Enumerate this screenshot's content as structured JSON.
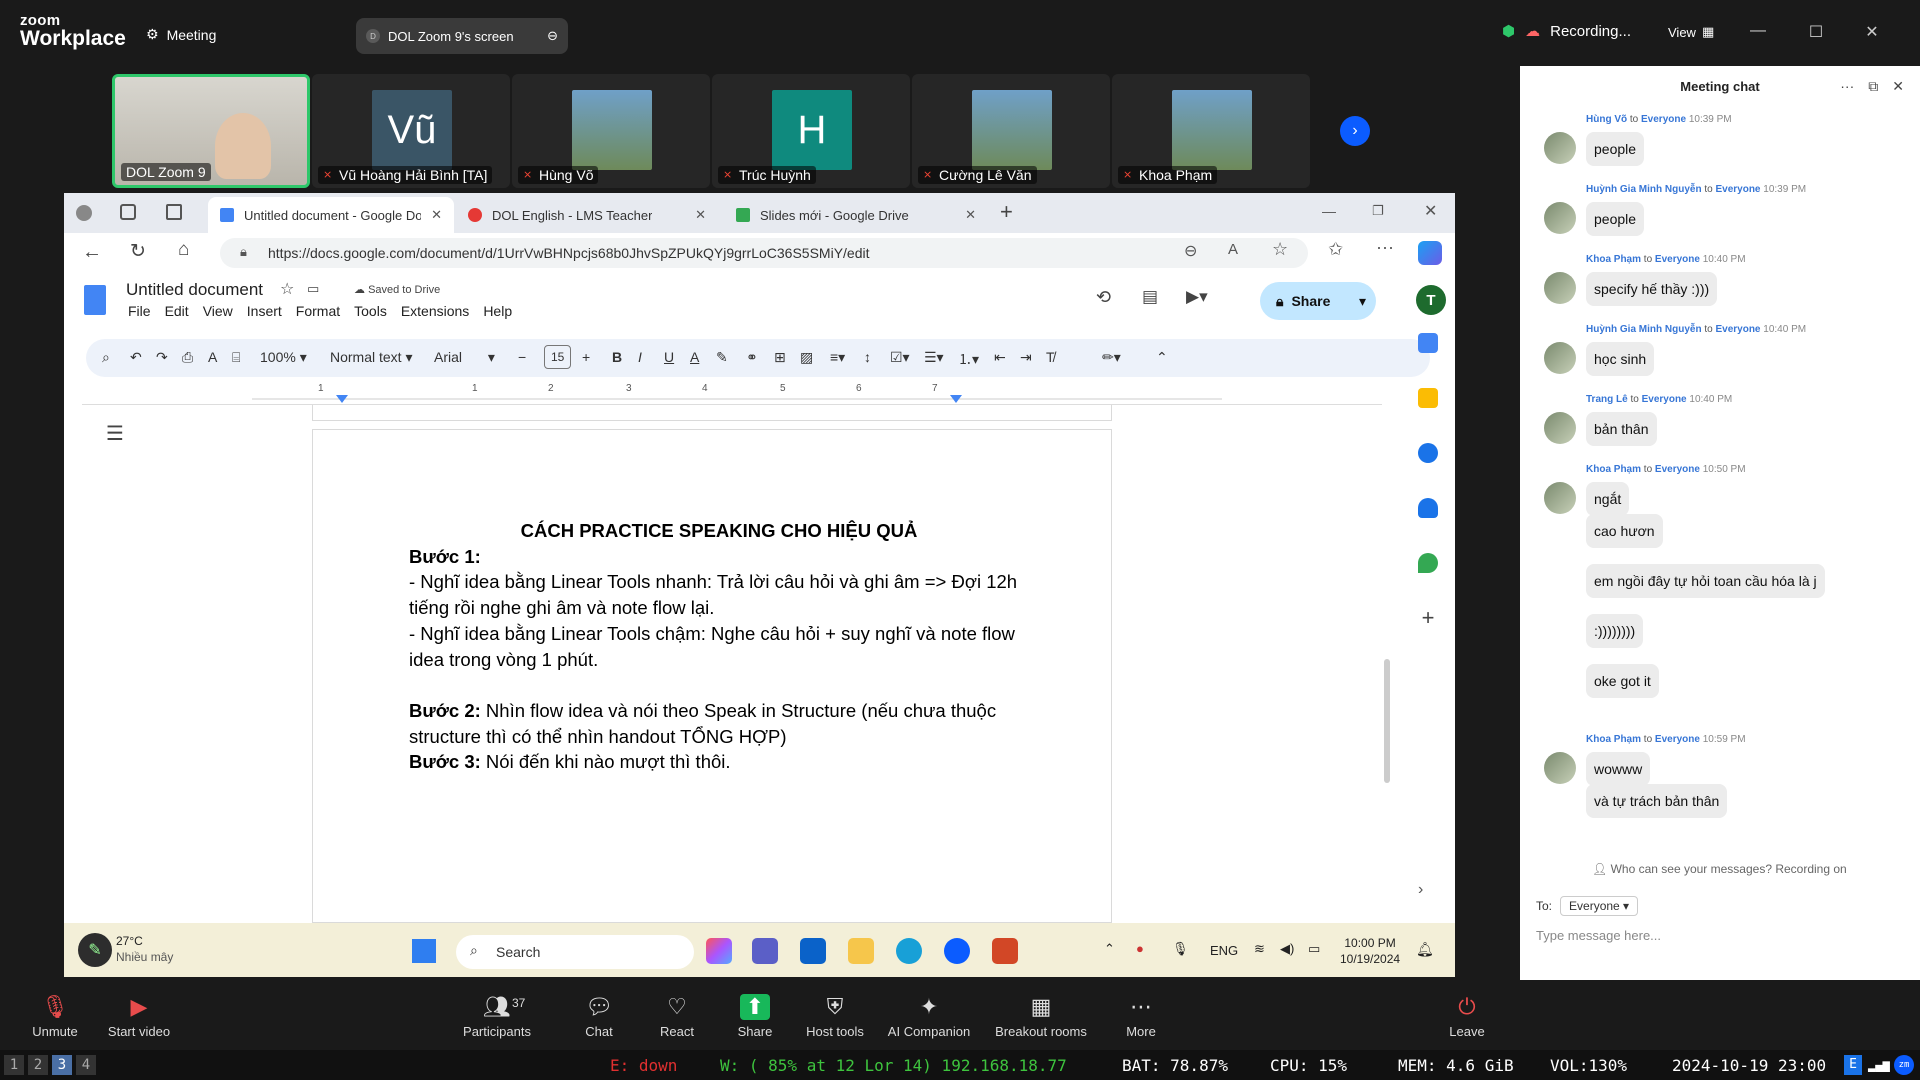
{
  "zoom": {
    "logo_line1": "zoom",
    "logo_line2": "Workplace",
    "meeting_label": "Meeting",
    "share_pill": {
      "initial": "D",
      "label": "DOL Zoom 9's screen"
    },
    "recording_label": "Recording...",
    "view_label": "View"
  },
  "thumbnails": [
    {
      "name": "DOL Zoom 9",
      "type": "video",
      "muted": false
    },
    {
      "name": "Vũ Hoàng Hải Bình [TA]",
      "type": "initials",
      "initials": "Vũ",
      "color": "#3a5566",
      "muted": true
    },
    {
      "name": "Hùng Võ",
      "type": "photo",
      "muted": true
    },
    {
      "name": "Trúc Huỳnh",
      "type": "initials",
      "initials": "H",
      "color": "#0f8a7e",
      "muted": true
    },
    {
      "name": "Cường Lê Văn",
      "type": "photo",
      "muted": true
    },
    {
      "name": "Khoa Phạm",
      "type": "photo",
      "muted": true
    }
  ],
  "chat": {
    "title": "Meeting chat",
    "messages": [
      {
        "sender": "Hùng Võ",
        "to": "to",
        "recipient": "Everyone",
        "time": "10:39 PM",
        "text": "people",
        "avatar": true
      },
      {
        "sender": "Huỳnh Gia Minh Nguyễn",
        "to": "to",
        "recipient": "Everyone",
        "time": "10:39 PM",
        "text": "people",
        "avatar": true
      },
      {
        "sender": "Khoa Phạm",
        "to": "to",
        "recipient": "Everyone",
        "time": "10:40 PM",
        "text": "specify hế thầy :)))",
        "avatar": true
      },
      {
        "sender": "Huỳnh Gia Minh Nguyễn",
        "to": "to",
        "recipient": "Everyone",
        "time": "10:40 PM",
        "text": "học sinh",
        "avatar": true
      },
      {
        "sender": "Trang Lê",
        "to": "to",
        "recipient": "Everyone",
        "time": "10:40 PM",
        "text": "bản thân",
        "avatar": true
      },
      {
        "sender": "Khoa Phạm",
        "to": "to",
        "recipient": "Everyone",
        "time": "10:50 PM",
        "text": "ngắt",
        "avatar": true
      },
      {
        "text": "cao hươn"
      },
      {
        "text": "em ngồi đây tự hỏi toan cầu hóa là j"
      },
      {
        "text": ":))))))))"
      },
      {
        "text": "oke got it"
      },
      {
        "sender": "Khoa Phạm",
        "to": "to",
        "recipient": "Everyone",
        "time": "10:59 PM",
        "text": "wowww",
        "avatar": true
      },
      {
        "text": "và tự trách bản thân"
      }
    ],
    "privacy_note": "Who can see your messages? Recording on",
    "to_label": "To:",
    "to_value": "Everyone",
    "input_placeholder": "Type message here..."
  },
  "browser": {
    "tabs": [
      {
        "label": "Untitled document - Google Docs",
        "active": true
      },
      {
        "label": "DOL English - LMS Teacher",
        "active": false
      },
      {
        "label": "Slides mới - Google Drive",
        "active": false
      }
    ],
    "url": "https://docs.google.com/document/d/1UrrVwBHNpcjs68b0JhvSpZPUkQYj9grrLoC36S5SMiY/edit"
  },
  "docs": {
    "title": "Untitled document",
    "saved_status": "Saved to Drive",
    "menu": [
      "File",
      "Edit",
      "View",
      "Insert",
      "Format",
      "Tools",
      "Extensions",
      "Help"
    ],
    "share_label": "Share",
    "avatar_initial": "T",
    "toolbar": {
      "zoom": "100%",
      "style": "Normal text",
      "font": "Arial",
      "size": "15"
    },
    "ruler_numbers": [
      "1",
      "1",
      "2",
      "3",
      "4",
      "5",
      "6",
      "7"
    ],
    "content": {
      "heading": "CÁCH PRACTICE SPEAKING CHO HIỆU QUẢ",
      "step1_label": "Bước 1:",
      "line1": "- Nghĩ idea bằng Linear Tools nhanh: Trả lời câu hỏi và ghi âm => Đợi 12h tiếng rồi nghe ghi âm và note flow lại.",
      "line2": "- Nghĩ idea bằng Linear Tools chậm: Nghe câu hỏi + suy nghĩ và note flow idea trong vòng 1 phút.",
      "step2_label": "Bước 2:",
      "step2_text": " Nhìn flow idea và nói theo Speak in Structure (nếu chưa thuộc structure thì có thể nhìn handout TỔNG HỢP)",
      "step3_label": "Bước 3:",
      "step3_text": " Nói đến khi nào mượt thì thôi."
    }
  },
  "taskbar": {
    "temp": "27°C",
    "weather": "Nhiều mây",
    "search_placeholder": "Search",
    "lang": "ENG",
    "time": "10:00 PM",
    "date": "10/19/2024"
  },
  "controls": [
    {
      "label": "Unmute",
      "icon": "mic-off-icon"
    },
    {
      "label": "Start video",
      "icon": "video-off-icon"
    },
    {
      "label": "Participants",
      "icon": "participants-icon",
      "count": "37"
    },
    {
      "label": "Chat",
      "icon": "chat-icon"
    },
    {
      "label": "React",
      "icon": "heart-icon"
    },
    {
      "label": "Share",
      "icon": "share-icon"
    },
    {
      "label": "Host tools",
      "icon": "shield-icon"
    },
    {
      "label": "AI Companion",
      "icon": "sparkle-icon"
    },
    {
      "label": "Breakout rooms",
      "icon": "grid-icon"
    },
    {
      "label": "More",
      "icon": "more-icon"
    },
    {
      "label": "Leave",
      "icon": "leave-icon"
    }
  ],
  "statusbar": {
    "workspaces": [
      "1",
      "2",
      "3",
      "4"
    ],
    "active_workspace": "3",
    "eth": "E: down",
    "wifi": "W: ( 85% at 12 Lor 14) 192.168.18.77",
    "bat": "BAT: 78.87%",
    "cpu": "CPU: 15%",
    "mem": "MEM: 4.6 GiB",
    "vol": "VOL:130%",
    "datetime": "2024-10-19 23:00",
    "colors": {
      "eth": "#e03030",
      "wifi": "#3ec43e",
      "default": "#ffffff"
    }
  }
}
